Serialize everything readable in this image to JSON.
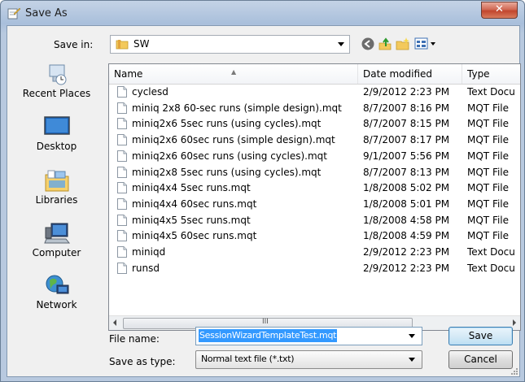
{
  "window": {
    "title": "Save As",
    "close_glyph": "✕"
  },
  "toolbar": {
    "save_in_label": "Save in:",
    "save_in_value": "SW",
    "icons": [
      "back-icon",
      "up-folder-icon",
      "new-folder-icon",
      "views-menu-icon"
    ]
  },
  "places": [
    {
      "label": "Recent Places",
      "icon": "recent-places-icon"
    },
    {
      "label": "Desktop",
      "icon": "desktop-icon"
    },
    {
      "label": "Libraries",
      "icon": "libraries-icon"
    },
    {
      "label": "Computer",
      "icon": "computer-icon"
    },
    {
      "label": "Network",
      "icon": "network-icon"
    }
  ],
  "columns": {
    "name": "Name",
    "date": "Date modified",
    "type": "Type"
  },
  "files": [
    {
      "name": "cyclesd",
      "date": "2/9/2012 2:23 PM",
      "type": "Text Docu"
    },
    {
      "name": "miniq 2x8 60-sec runs (simple design).mqt",
      "date": "8/7/2007 8:16 PM",
      "type": "MQT File"
    },
    {
      "name": "miniq2x6 5sec runs (using cycles).mqt",
      "date": "8/7/2007 8:15 PM",
      "type": "MQT File"
    },
    {
      "name": "miniq2x6 60sec runs (simple design).mqt",
      "date": "8/7/2007 8:17 PM",
      "type": "MQT File"
    },
    {
      "name": "miniq2x6 60sec runs (using cycles).mqt",
      "date": "9/1/2007 5:56 PM",
      "type": "MQT File"
    },
    {
      "name": "miniq2x8 5sec runs (using cycles).mqt",
      "date": "8/7/2007 8:13 PM",
      "type": "MQT File"
    },
    {
      "name": "miniq4x4 5sec runs.mqt",
      "date": "1/8/2008 5:02 PM",
      "type": "MQT File"
    },
    {
      "name": "miniq4x4 60sec runs.mqt",
      "date": "1/8/2008 5:01 PM",
      "type": "MQT File"
    },
    {
      "name": "miniq4x5 5sec runs.mqt",
      "date": "1/8/2008 4:58 PM",
      "type": "MQT File"
    },
    {
      "name": "miniq4x5 60sec runs.mqt",
      "date": "1/8/2008 4:59 PM",
      "type": "MQT File"
    },
    {
      "name": "miniqd",
      "date": "2/9/2012 2:23 PM",
      "type": "Text Docu"
    },
    {
      "name": "runsd",
      "date": "2/9/2012 2:23 PM",
      "type": "Text Docu"
    }
  ],
  "scrollbar": {
    "grip": "III"
  },
  "form": {
    "file_name_label": "File name:",
    "file_name_value": "SessionWizardTemplateTest.mqt",
    "save_type_label": "Save as type:",
    "save_type_value": "Normal text file (*.txt)",
    "save_button": "Save",
    "cancel_button": "Cancel"
  }
}
